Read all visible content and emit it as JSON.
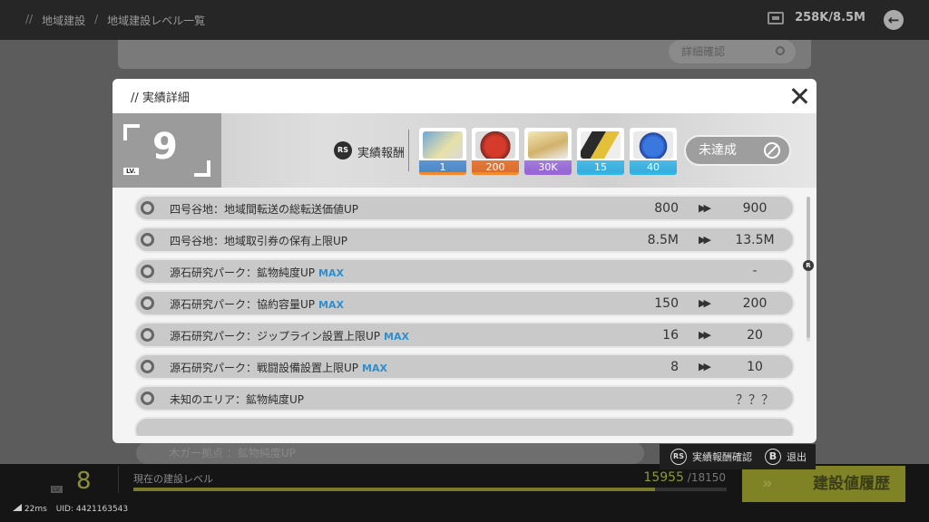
{
  "header": {
    "breadcrumb": [
      "地域建設",
      "地域建設レベル一覧"
    ],
    "currency": "258K/8.5M",
    "currency_icon": "currency-icon",
    "back_icon": "back-arrow-icon"
  },
  "search": {
    "detail_label": "詳細確認"
  },
  "behind_row": {
    "label": "木ガー拠点 ：鉱物純度UP"
  },
  "bottom": {
    "level": "8",
    "lv_tag": "LV.",
    "build_level_label": "現在の建設レベル",
    "build_current": "15955",
    "build_total": "/18150",
    "build_progress": 0.879,
    "history_button": "建設値履歴"
  },
  "status": {
    "ping": "22ms",
    "uid": "UID: 4421163543"
  },
  "modal": {
    "title": "// 実績詳細",
    "level": "9",
    "lv_tag": "LV.",
    "rs_key": "RS",
    "reward_label": "実績報酬",
    "rewards": [
      {
        "qty": "1",
        "icon": "ticket-icon",
        "color": "#f08a2c"
      },
      {
        "qty": "200",
        "icon": "red-crystal-icon",
        "color": "#f08a2c"
      },
      {
        "qty": "30K",
        "icon": "gold-bars-icon",
        "color": "#9a66d8"
      },
      {
        "qty": "15",
        "icon": "exp-card-icon",
        "color": "#33b5e6"
      },
      {
        "qty": "40",
        "icon": "blue-crystal-icon",
        "color": "#33b5e6"
      }
    ],
    "status_button": "未達成",
    "rows": [
      {
        "name": "四号谷地：地域間転送の総転送価値UP",
        "max": "",
        "from": "800",
        "to": "900"
      },
      {
        "name": "四号谷地：地域取引券の保有上限UP",
        "max": "",
        "from": "8.5M",
        "to": "13.5M"
      },
      {
        "name": "源石研究パーク：鉱物純度UP",
        "max": "MAX",
        "from": "",
        "to": "-"
      },
      {
        "name": "源石研究パーク：協約容量UP",
        "max": "MAX",
        "from": "150",
        "to": "200"
      },
      {
        "name": "源石研究パーク：ジップライン設置上限UP",
        "max": "MAX",
        "from": "16",
        "to": "20"
      },
      {
        "name": "源石研究パーク：戦闘設備設置上限UP",
        "max": "MAX",
        "from": "8",
        "to": "10"
      },
      {
        "name": "未知のエリア：鉱物純度UP",
        "max": "",
        "from": "",
        "to": "？？？"
      }
    ],
    "arrow": "▶▶",
    "scroll_key": "R"
  },
  "footer": {
    "rs_key": "RS",
    "confirm_label": "実績報酬確認",
    "b_key": "B",
    "exit_label": "退出"
  }
}
